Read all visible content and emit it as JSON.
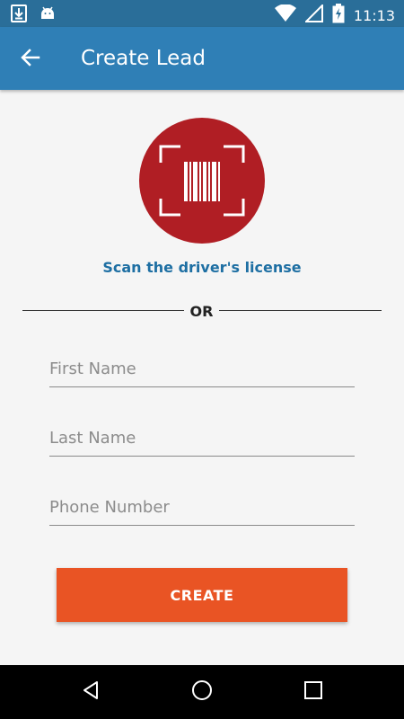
{
  "status_bar": {
    "time": "11:13",
    "icons": [
      "download-icon",
      "android-icon",
      "wifi-icon",
      "signal-icon",
      "battery-charging-icon"
    ]
  },
  "app_bar": {
    "title": "Create Lead",
    "back_icon": "arrow-back-icon"
  },
  "scanner": {
    "icon": "barcode-scan-icon",
    "label": "Scan the driver's license",
    "circle_color": "#b01e24"
  },
  "divider": {
    "text": "OR"
  },
  "form": {
    "first_name": {
      "placeholder": "First Name",
      "value": ""
    },
    "last_name": {
      "placeholder": "Last Name",
      "value": ""
    },
    "phone": {
      "placeholder": "Phone Number",
      "value": ""
    }
  },
  "create_button": {
    "label": "CREATE",
    "color": "#e95424"
  },
  "nav_bar": {
    "icons": [
      "nav-back-icon",
      "nav-home-icon",
      "nav-recents-icon"
    ]
  },
  "colors": {
    "status_bar": "#2a6e99",
    "app_bar": "#2f7fb6",
    "accent_text": "#1e6fa3"
  }
}
